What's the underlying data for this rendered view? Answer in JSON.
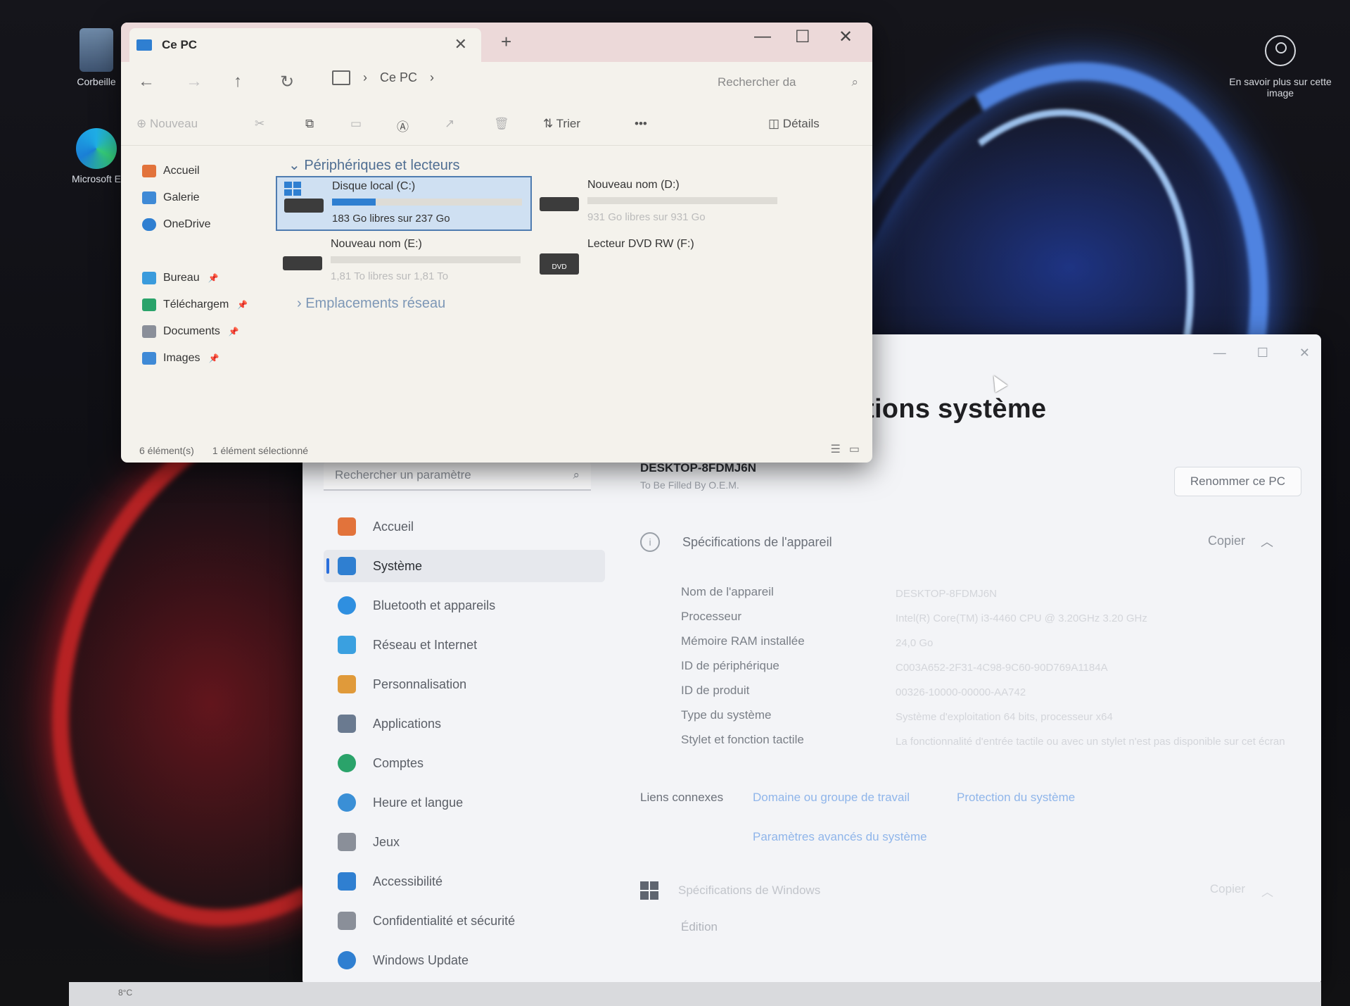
{
  "desktop": {
    "icons": [
      {
        "label": "Corbeille"
      },
      {
        "label": "Microsoft E"
      }
    ],
    "learn_more": "En savoir plus sur cette image"
  },
  "explorer": {
    "tab_title": "Ce PC",
    "breadcrumb": "Ce PC",
    "search_placeholder": "Rechercher da",
    "toolbar": {
      "new": "Nouveau",
      "sort": "Trier",
      "more": "•••",
      "details": "Détails"
    },
    "sidebar": [
      {
        "label": "Accueil",
        "color": "#e2733b"
      },
      {
        "label": "Galerie",
        "color": "#3f8ad6"
      },
      {
        "label": "OneDrive",
        "color": "#2f7fd1"
      },
      {
        "label": "Bureau",
        "color": "#3a9bdc"
      },
      {
        "label": "Téléchargem",
        "color": "#2aa36a"
      },
      {
        "label": "Documents",
        "color": "#8a8f99"
      },
      {
        "label": "Images",
        "color": "#3f8ad6"
      }
    ],
    "sections": {
      "devices": "Périphériques et lecteurs",
      "network": "Emplacements réseau"
    },
    "drives": [
      {
        "name": "Disque local (C:)",
        "free": "183 Go libres sur 237 Go",
        "used_fraction": 0.23
      },
      {
        "name": "Nouveau nom (D:)",
        "free": "931 Go libres sur 931 Go",
        "used_fraction": 0.0
      },
      {
        "name": "Nouveau nom (E:)",
        "free": "1,81 To libres sur 1,81 To",
        "used_fraction": 0.0
      },
      {
        "name": "Lecteur DVD RW (F:)",
        "badge": "DVD"
      }
    ],
    "status": {
      "count": "6 élément(s)",
      "selected": "1 élément sélectionné"
    },
    "accent": "#2f7fd1"
  },
  "settings": {
    "title": "tions système",
    "search_placeholder": "Rechercher un paramètre",
    "nav": [
      {
        "label": "Accueil",
        "color": "#e2733b"
      },
      {
        "label": "Système",
        "color": "#2f7fd1"
      },
      {
        "label": "Bluetooth et appareils",
        "color": "#2f8fe0"
      },
      {
        "label": "Réseau et Internet",
        "color": "#3aa0e0"
      },
      {
        "label": "Personnalisation",
        "color": "#e09a3a"
      },
      {
        "label": "Applications",
        "color": "#6a7a90"
      },
      {
        "label": "Comptes",
        "color": "#2aa36a"
      },
      {
        "label": "Heure et langue",
        "color": "#3a8fd6"
      },
      {
        "label": "Jeux",
        "color": "#8a8f99"
      },
      {
        "label": "Accessibilité",
        "color": "#2f7fd1"
      },
      {
        "label": "Confidentialité et sécurité",
        "color": "#8a8f99"
      },
      {
        "label": "Windows Update",
        "color": "#2f7fd1"
      }
    ],
    "device_name": "DESKTOP-8FDMJ6N",
    "device_model": "To Be Filled By O.E.M.",
    "rename": "Renommer ce PC",
    "device_specs": {
      "header": "Spécifications de l'appareil",
      "copy": "Copier",
      "rows": [
        {
          "k": "Nom de l'appareil",
          "v": "DESKTOP-8FDMJ6N"
        },
        {
          "k": "Processeur",
          "v": "Intel(R) Core(TM) i3-4460  CPU @ 3.20GHz   3.20 GHz"
        },
        {
          "k": "Mémoire RAM installée",
          "v": "24,0 Go"
        },
        {
          "k": "ID de périphérique",
          "v": "C003A652-2F31-4C98-9C60-90D769A1184A"
        },
        {
          "k": "ID de produit",
          "v": "00326-10000-00000-AA742"
        },
        {
          "k": "Type du système",
          "v": "Système d'exploitation 64 bits, processeur x64"
        },
        {
          "k": "Stylet et fonction tactile",
          "v": "La fonctionnalité d'entrée tactile ou avec un stylet n'est pas disponible sur cet écran"
        }
      ]
    },
    "related": {
      "label": "Liens connexes",
      "links": [
        "Domaine ou groupe de travail",
        "Protection du système",
        "Paramètres avancés du système"
      ]
    },
    "windows_specs": {
      "header": "Spécifications de Windows",
      "copy": "Copier",
      "edition_label": "Édition"
    }
  },
  "taskbar": {
    "weather": "8°C"
  }
}
